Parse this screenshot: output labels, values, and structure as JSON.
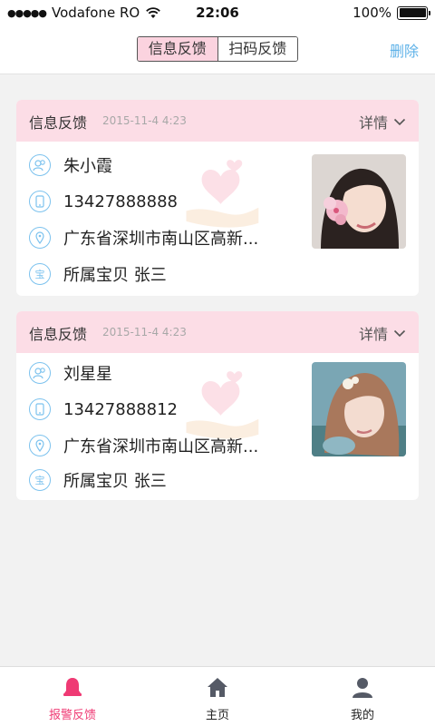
{
  "status_bar": {
    "signal": "●●●●●",
    "carrier": "Vodafone RO",
    "time": "22:06",
    "battery": "100%"
  },
  "nav": {
    "segments": [
      "信息反馈",
      "扫码反馈"
    ],
    "active_segment": 0,
    "right_action": "删除"
  },
  "cards": [
    {
      "title": "信息反馈",
      "date": "2015-11-4  4:23",
      "detail_label": "详情",
      "name": "朱小霞",
      "phone": "13427888888",
      "address": "广东省深圳市南山区高新...",
      "baby_icon": "宝",
      "baby": "所属宝贝  张三"
    },
    {
      "title": "信息反馈",
      "date": "2015-11-4  4:23",
      "detail_label": "详情",
      "name": "刘星星",
      "phone": "13427888812",
      "address": "广东省深圳市南山区高新...",
      "baby_icon": "宝",
      "baby": "所属宝贝  张三"
    }
  ],
  "tabs": [
    {
      "label": "报警反馈",
      "icon": "bell-icon"
    },
    {
      "label": "主页",
      "icon": "home-icon"
    },
    {
      "label": "我的",
      "icon": "person-icon"
    }
  ],
  "colors": {
    "accent_pink": "#ef3a74",
    "header_pink": "#fcdde6",
    "icon_blue": "#7cc2ee",
    "link_blue": "#5fb2e8"
  }
}
